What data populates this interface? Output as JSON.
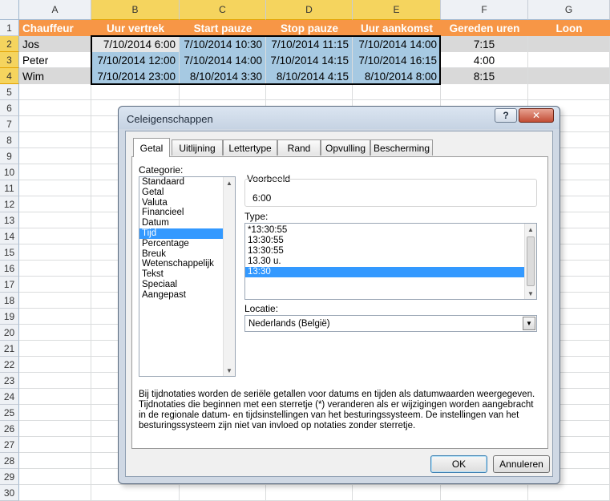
{
  "sheet": {
    "columns": [
      "A",
      "B",
      "C",
      "D",
      "E",
      "F",
      "G"
    ],
    "rows": [
      "1",
      "2",
      "3",
      "4",
      "5",
      "6",
      "7",
      "8",
      "9",
      "10",
      "11",
      "12",
      "13",
      "14",
      "15",
      "16",
      "17",
      "18",
      "19",
      "20",
      "21",
      "22",
      "23",
      "24",
      "25",
      "26",
      "27",
      "28",
      "29",
      "30"
    ],
    "header": [
      "Chauffeur",
      "Uur vertrek",
      "Start pauze",
      "Stop pauze",
      "Uur aankomst",
      "Gereden uren",
      "Loon"
    ],
    "data": [
      [
        "Jos",
        "7/10/2014 6:00",
        "7/10/2014 10:30",
        "7/10/2014 11:15",
        "7/10/2014 14:00",
        "7:15",
        ""
      ],
      [
        "Peter",
        "7/10/2014 12:00",
        "7/10/2014 14:00",
        "7/10/2014 14:15",
        "7/10/2014 16:15",
        "4:00",
        ""
      ],
      [
        "Wim",
        "7/10/2014 23:00",
        "8/10/2014 3:30",
        "8/10/2014 4:15",
        "8/10/2014 8:00",
        "8:15",
        ""
      ]
    ],
    "colors": {
      "header_fill": "#f79646",
      "band_fill": "#d9d9d9",
      "selection_fill": "#a6c9e2"
    }
  },
  "dialog": {
    "title": "Celeigenschappen",
    "help_glyph": "?",
    "close_glyph": "✕",
    "tabs": [
      "Getal",
      "Uitlijning",
      "Lettertype",
      "Rand",
      "Opvulling",
      "Bescherming"
    ],
    "active_tab": "Getal",
    "category_label": "Categorie:",
    "categories": [
      "Standaard",
      "Getal",
      "Valuta",
      "Financieel",
      "Datum",
      "Tijd",
      "Percentage",
      "Breuk",
      "Wetenschappelijk",
      "Tekst",
      "Speciaal",
      "Aangepast"
    ],
    "selected_category": "Tijd",
    "preview_label": "Voorbeeld",
    "preview_value": "6:00",
    "type_label": "Type:",
    "types": [
      "*13:30:55",
      "13:30:55",
      "13:30:55",
      "13.30 u.",
      "13:30"
    ],
    "selected_type": "13:30",
    "locale_label": "Locatie:",
    "locale_value": "Nederlands (België)",
    "description": "Bij tijdnotaties worden de seriële getallen voor datums en tijden als datumwaarden weergegeven. Tijdnotaties die beginnen met een sterretje (*) veranderen als er wijzigingen worden aangebracht in de regionale datum- en tijdsinstellingen van het besturingssysteem. De instellingen van het besturingssysteem zijn niet van invloed op notaties zonder sterretje.",
    "ok_label": "OK",
    "cancel_label": "Annuleren"
  }
}
